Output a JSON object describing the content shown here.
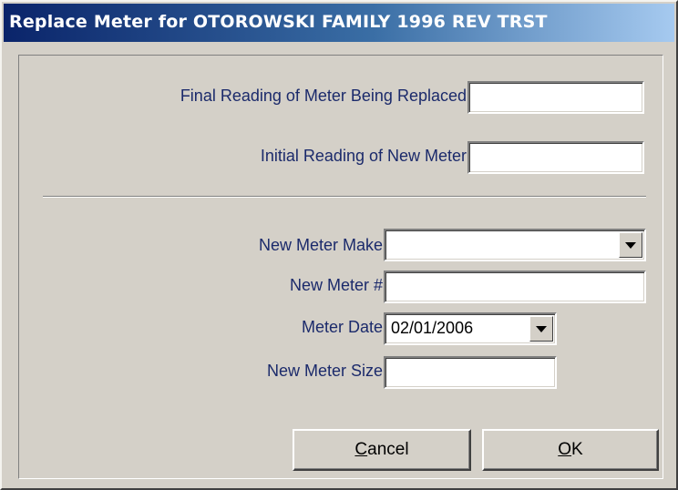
{
  "window": {
    "title": "Replace Meter for OTOROWSKI FAMILY 1996 REV TRST"
  },
  "fields": {
    "final_reading": {
      "label": "Final Reading of Meter Being Replaced:",
      "value": ""
    },
    "initial_reading": {
      "label": "Initial Reading of New Meter:",
      "value": ""
    },
    "meter_make": {
      "label": "New Meter Make:",
      "value": ""
    },
    "meter_number": {
      "label": "New Meter #:",
      "value": ""
    },
    "meter_date": {
      "label": "Meter Date:",
      "value": "02/01/2006"
    },
    "meter_size": {
      "label": "New Meter Size:",
      "value": ""
    }
  },
  "buttons": {
    "cancel": {
      "mnemonic": "C",
      "rest": "ancel"
    },
    "ok": {
      "mnemonic": "O",
      "rest": "K"
    }
  },
  "icons": {
    "dropdown": "chevron-down-icon"
  }
}
